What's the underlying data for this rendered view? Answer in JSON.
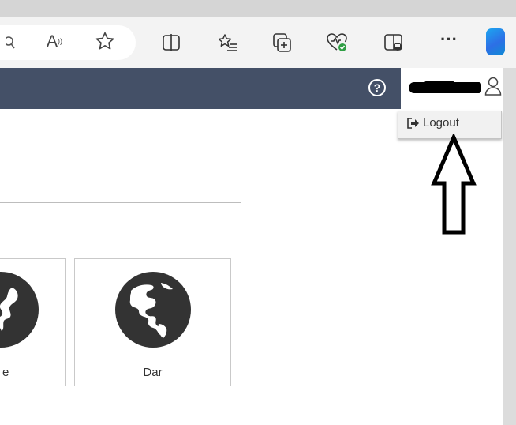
{
  "browser": {
    "toolbar_icons": [
      "search-icon",
      "read-aloud-icon",
      "favorite-star-icon",
      "split-screen-icon",
      "favorites-list-icon",
      "collections-icon",
      "browser-essentials-icon",
      "sidebar-icon",
      "more-icon",
      "copilot-icon"
    ],
    "more_label": "···",
    "read_aloud_label": "A"
  },
  "header": {
    "background": "#445067",
    "help_label": "?"
  },
  "user_menu": {
    "icon": "user-icon",
    "items": [
      {
        "label": "Logout",
        "icon": "logout-icon"
      }
    ]
  },
  "tiles": [
    {
      "label": "e",
      "icon": "globe-icon"
    },
    {
      "label": "Dar",
      "icon": "globe-icon"
    }
  ],
  "annotation": {
    "icon": "arrow-up-outline-icon"
  }
}
